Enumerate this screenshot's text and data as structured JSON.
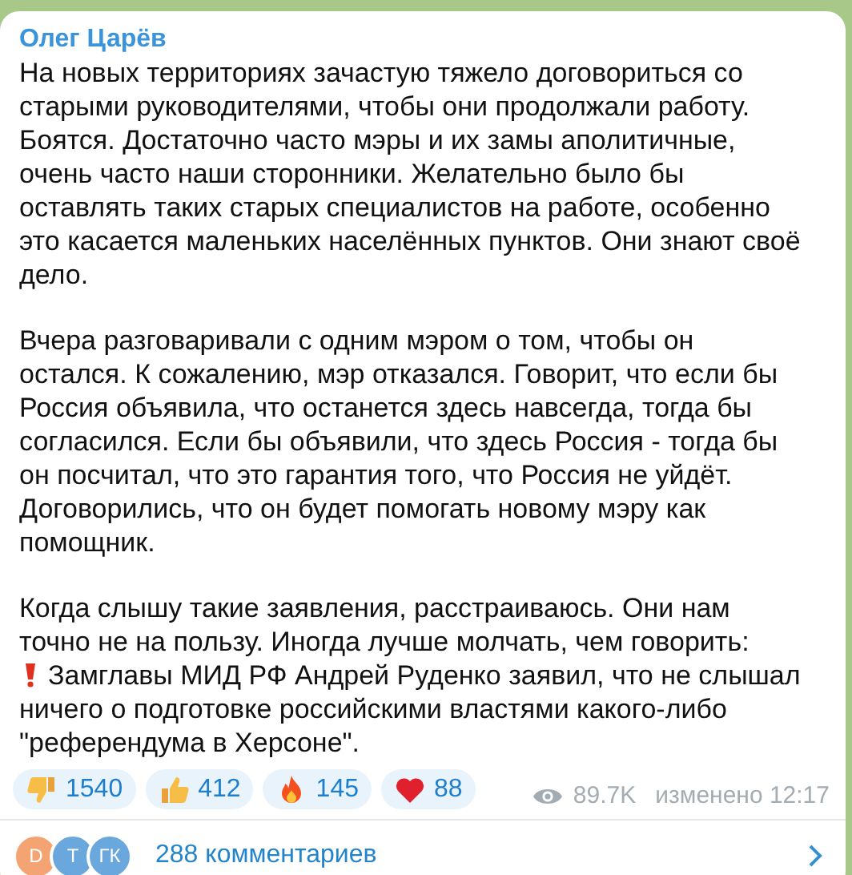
{
  "post": {
    "author": "Олег Царёв",
    "paragraphs": [
      {
        "kind": "text",
        "text": "На новых территориях зачастую тяжело договориться со старыми руководителями, чтобы они продолжали работу. Боятся. Достаточно часто мэры и их замы аполитичные, очень часто наши сторонники. Желательно было бы оставлять таких старых специалистов на работе, особенно это касается маленьких населённых пунктов.  Они знают своё дело."
      },
      {
        "kind": "text",
        "text": "Вчера разговаривали с одним мэром о том, чтобы он остался. К сожалению, мэр отказался. Говорит, что если бы Россия объявила, что останется здесь навсегда, тогда бы согласился. Если бы объявили, что здесь Россия - тогда бы он посчитал, что это гарантия того, что Россия не уйдёт. Договорились, что он будет помогать новому мэру как помощник."
      },
      {
        "kind": "text",
        "text": "Когда слышу такие заявления, расстраиваюсь. Они нам точно не на пользу. Иногда лучше молчать, чем говорить:"
      },
      {
        "kind": "alert",
        "text": "Замглавы МИД РФ Андрей Руденко заявил, что не слышал ничего о подготовке российскими властями какого-либо \"референдума в Херсоне\"."
      }
    ],
    "reactions": [
      {
        "kind": "thumbs_down",
        "count": "1540"
      },
      {
        "kind": "thumbs_up",
        "count": "412"
      },
      {
        "kind": "fire",
        "count": "145"
      },
      {
        "kind": "heart",
        "count": "88"
      }
    ],
    "views": "89.7K",
    "edited": "изменено 12:17",
    "comments": {
      "avatars": [
        {
          "initials": "D",
          "color": "#f4a373"
        },
        {
          "initials": "T",
          "color": "#6aa7dc"
        },
        {
          "initials": "ГК",
          "color": "#6aa7dc"
        }
      ],
      "label": "288 комментариев"
    }
  }
}
